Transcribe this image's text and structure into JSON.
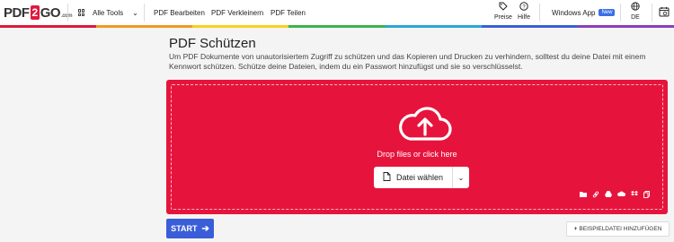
{
  "header": {
    "logo": {
      "pdf": "PDF",
      "two": "2",
      "go": "GO",
      "com": ".com"
    },
    "all_tools": "Alle Tools",
    "nav": [
      "PDF Bearbeiten",
      "PDF Verkleinern",
      "PDF Teilen"
    ],
    "preise": "Preise",
    "hilfe": "Hilfe",
    "windows_app": "Windows App",
    "new_badge": "New",
    "lang": "DE"
  },
  "main": {
    "title": "PDF Schützen",
    "description": "Um PDF Dokumente von unautorisiertem Zugriff zu schützen und das Kopieren und Drucken zu verhindern, solltest du deine Datei mit einem Kennwort schützen. Schütze deine Dateien, indem du ein Passwort hinzufügst und sie so verschlüsselst.",
    "drop_text": "Drop files or click here",
    "choose_file": "Datei wählen",
    "start": "START",
    "sample_file": "BEISPIELDATEI HINZUFÜGEN"
  },
  "colors": {
    "brand_red": "#e6143c",
    "start_blue": "#3a5ed8",
    "stripe": [
      "#e0183c",
      "#f19a1e",
      "#f7d21c",
      "#3db24b",
      "#2aa7d6",
      "#3a5ed8",
      "#8a3fb8"
    ]
  },
  "icons": {
    "grid": "grid-icon",
    "tag": "price-tag-icon",
    "help": "help-circle-icon",
    "globe": "globe-icon",
    "calendar": "history-icon",
    "upload": "cloud-upload-icon",
    "file": "file-icon"
  }
}
